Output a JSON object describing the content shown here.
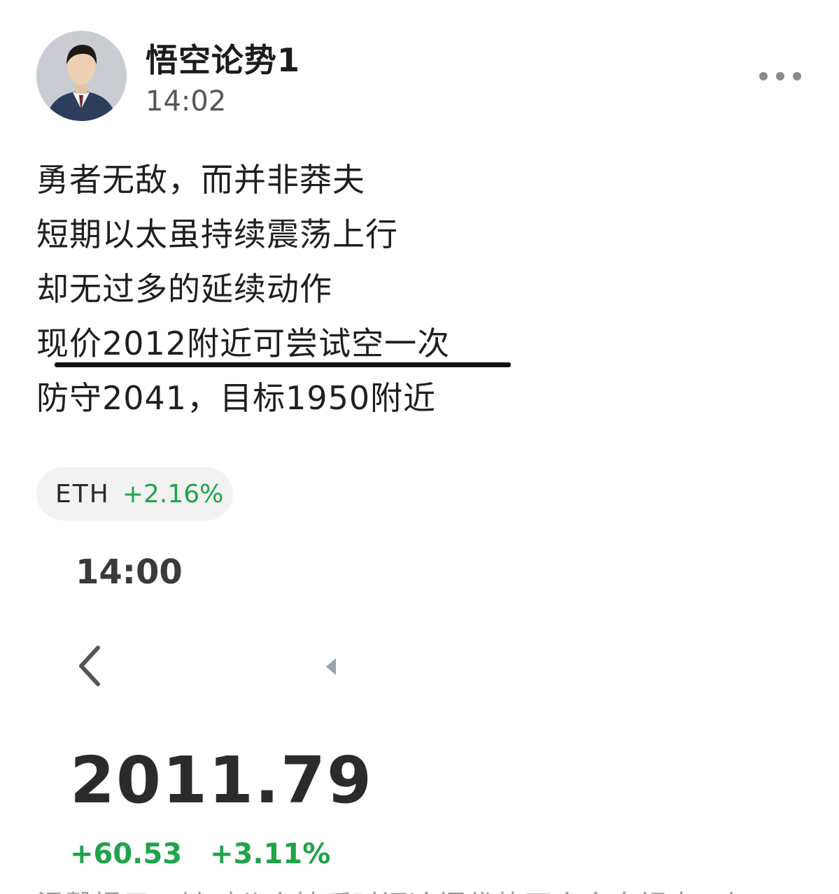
{
  "post": {
    "author": "悟空论势1",
    "time": "14:02",
    "avatar_icon": "person-in-suit-avatar",
    "more_icon": "more-dots-icon",
    "lines": [
      "勇者无敌，而并非莽夫",
      "短期以太虽持续震荡上行",
      "却无过多的延续动作",
      "现价2012附近可尝试空一次",
      "防守2041，目标1950附近"
    ]
  },
  "ticker": {
    "symbol": "ETH",
    "change": "+2.16%",
    "positive_color": "#1fa34a"
  },
  "quote": {
    "time": "14:00",
    "back_icon": "chevron-left-icon",
    "triangle_icon": "small-triangle-left-icon",
    "price": "2011.79",
    "change_abs": "+60.53",
    "change_pct": "+3.11%"
  },
  "footer": {
    "partial_line": "温馨提示：针对公众持币时间冷门优势不会会大视点一加"
  }
}
